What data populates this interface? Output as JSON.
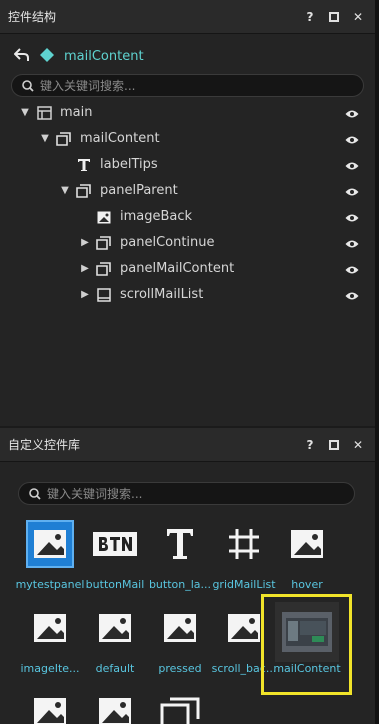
{
  "structure_panel": {
    "title": "控件结构",
    "help_label": "?",
    "close_label": "✕",
    "breadcrumb": "mailContent",
    "search_placeholder": "键入关键词搜索..."
  },
  "tree": [
    {
      "label": "main",
      "expanded": true,
      "icon": "layout-icon"
    },
    {
      "label": "mailContent",
      "expanded": true,
      "icon": "panel-icon"
    },
    {
      "label": "labelTips",
      "icon": "text-icon"
    },
    {
      "label": "panelParent",
      "expanded": true,
      "icon": "panel-icon"
    },
    {
      "label": "imageBack",
      "icon": "image-icon"
    },
    {
      "label": "panelContinue",
      "expanded": false,
      "icon": "panel-icon"
    },
    {
      "label": "panelMailContent",
      "expanded": false,
      "icon": "panel-icon"
    },
    {
      "label": "scrollMailList",
      "expanded": false,
      "icon": "scroll-icon"
    }
  ],
  "library_panel": {
    "title": "自定义控件库",
    "help_label": "?",
    "close_label": "✕",
    "search_placeholder": "键入关键词搜索..."
  },
  "tiles": [
    {
      "label": "mytestpanel",
      "icon": "image-icon",
      "selected": true
    },
    {
      "label": "buttonMail",
      "icon": "btn-icon"
    },
    {
      "label": "button_la...",
      "icon": "text-icon"
    },
    {
      "label": "gridMailList",
      "icon": "grid-icon"
    },
    {
      "label": "hover",
      "icon": "image-icon"
    },
    {
      "label": "imageIte...",
      "icon": "image-icon"
    },
    {
      "label": "default",
      "icon": "image-icon"
    },
    {
      "label": "pressed",
      "icon": "image-icon"
    },
    {
      "label": "scroll_bac...",
      "icon": "image-icon"
    },
    {
      "label": "mailContent",
      "icon": "thumbnail",
      "highlighted": true
    },
    {
      "label": "",
      "icon": "image-icon"
    },
    {
      "label": "",
      "icon": "image-icon"
    },
    {
      "label": "",
      "icon": "panel-icon"
    }
  ],
  "colors": {
    "accent": "#5fd3d0",
    "tile_label": "#59c6e0",
    "highlight": "#f1e42a",
    "selection": "#1f7fd4"
  }
}
